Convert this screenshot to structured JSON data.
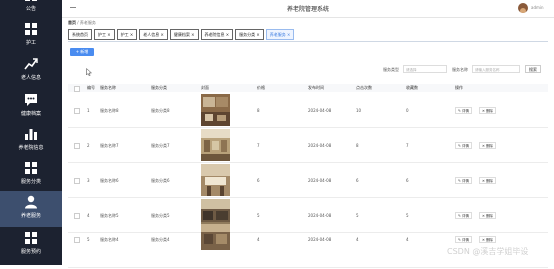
{
  "app": {
    "title": "养老院管理系统",
    "user": "admin"
  },
  "sidebar": {
    "items": [
      {
        "label": "公告",
        "icon": "grid-icon"
      },
      {
        "label": "护工",
        "icon": "grid-icon"
      },
      {
        "label": "老人信息",
        "icon": "trend-icon"
      },
      {
        "label": "健康档案",
        "icon": "chat-icon"
      },
      {
        "label": "养老院信息",
        "icon": "bar-chart-icon"
      },
      {
        "label": "服务分类",
        "icon": "grid-icon"
      },
      {
        "label": "养老服务",
        "icon": "user-icon",
        "active": true
      },
      {
        "label": "服务预约",
        "icon": "grid-icon"
      }
    ]
  },
  "breadcrumb": {
    "home": "首页",
    "current": "养老服务"
  },
  "tabs": [
    {
      "label": "系统首页"
    },
    {
      "label": "护工 ×"
    },
    {
      "label": "护工 ×"
    },
    {
      "label": "老人信息 ×"
    },
    {
      "label": "健康档案 ×"
    },
    {
      "label": "养老院信息 ×"
    },
    {
      "label": "服务分类 ×"
    },
    {
      "label": "养老服务 ×",
      "active": true
    }
  ],
  "toolbar": {
    "add_label": "+ 新增"
  },
  "filters": {
    "category_label": "服务类型",
    "category_placeholder": "请选择",
    "name_label": "服务名称",
    "name_placeholder": "请输入服务名称",
    "search_label": "搜索"
  },
  "table": {
    "columns": [
      "编号",
      "服务名称",
      "服务分类",
      "封面",
      "价格",
      "发布时间",
      "点击次数",
      "收藏数",
      "操作"
    ],
    "rows": [
      {
        "no": "1",
        "name": "服务名称8",
        "category": "服务分类8",
        "price": "8",
        "date": "2024-04-08",
        "clicks": "10",
        "favs": "0"
      },
      {
        "no": "2",
        "name": "服务名称7",
        "category": "服务分类7",
        "price": "7",
        "date": "2024-04-08",
        "clicks": "8",
        "favs": "7"
      },
      {
        "no": "3",
        "name": "服务名称6",
        "category": "服务分类6",
        "price": "6",
        "date": "2024-04-08",
        "clicks": "6",
        "favs": "6"
      },
      {
        "no": "4",
        "name": "服务名称5",
        "category": "服务分类5",
        "price": "5",
        "date": "2024-04-08",
        "clicks": "5",
        "favs": "5"
      },
      {
        "no": "5",
        "name": "服务名称4",
        "category": "服务分类4",
        "price": "4",
        "date": "2024-04-08",
        "clicks": "4",
        "favs": "4"
      }
    ],
    "edit_label": "✎ 详情",
    "delete_label": "✕ 删除"
  },
  "watermark": "CSDN @溪吉学姐毕设"
}
